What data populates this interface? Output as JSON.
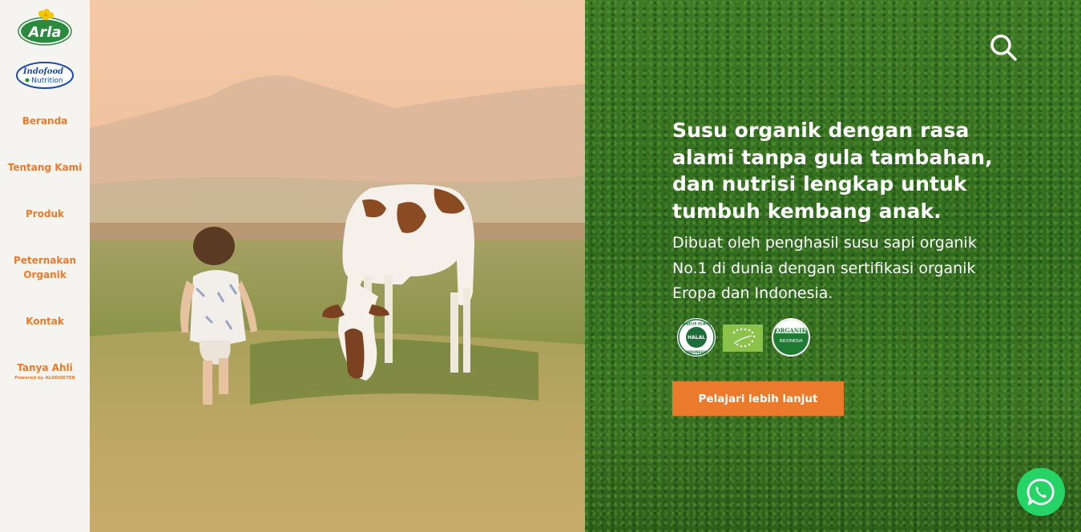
{
  "sidebar": {
    "logo_arla": "Arla",
    "logo_indofood_line1": "Indofood",
    "logo_indofood_line2": "Nutrition",
    "items": [
      {
        "label": "Beranda"
      },
      {
        "label": "Tentang Kami"
      },
      {
        "label": "Produk"
      },
      {
        "label": "Peternakan Organik"
      },
      {
        "label": "Kontak"
      },
      {
        "label": "Tanya Ahli",
        "sub": "Powered by ALODOKTER"
      }
    ]
  },
  "hero": {
    "headline": "Susu organik dengan rasa alami tanpa gula tambahan, dan nutrisi lengkap untuk tumbuh kembang anak.",
    "subtext": "Dibuat oleh penghasil susu sapi organik No.1 di dunia dengan sertifikasi organik Eropa dan Indonesia.",
    "badges": {
      "halal_top": "MAJELIS ULAMA",
      "halal_center": "HALAL",
      "halal_bottom": "INDONESIA",
      "organik_top": "ORGANIK",
      "organik_bottom": "INDONESIA"
    },
    "cta_label": "Pelajari lebih lanjut"
  },
  "icons": {
    "search": "search-icon",
    "whatsapp": "whatsapp-icon"
  },
  "colors": {
    "accent": "#ec7a2c",
    "sidebar_bg": "#f5f4f0",
    "whatsapp": "#25d366",
    "grass": "#3d7a26"
  }
}
